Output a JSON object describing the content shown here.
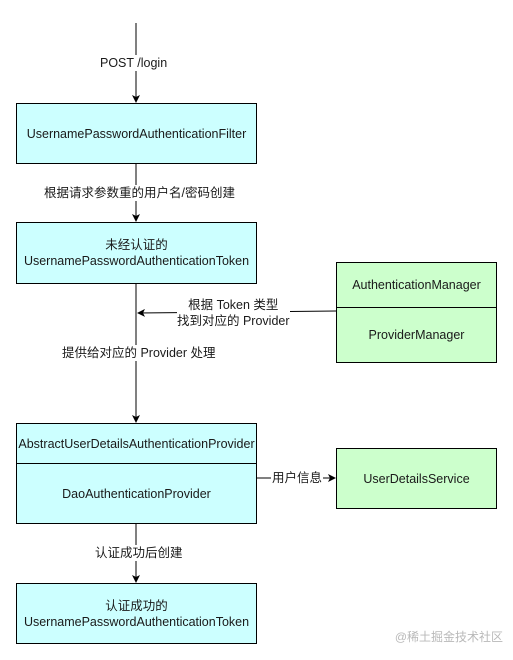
{
  "nodes": {
    "filter": {
      "label": "UsernamePasswordAuthenticationFilter",
      "color": "#ccffff"
    },
    "unauth_token": {
      "line1": "未经认证的",
      "line2": "UsernamePasswordAuthenticationToken",
      "color": "#ccffff"
    },
    "manager": {
      "top": "AuthenticationManager",
      "bottom": "ProviderManager",
      "color": "#ccffcc"
    },
    "provider": {
      "top": "AbstractUserDetailsAuthenticationProvider",
      "bottom": "DaoAuthenticationProvider",
      "color": "#ccffff"
    },
    "user_details_service": {
      "label": "UserDetailsService",
      "color": "#ccffcc"
    },
    "auth_token": {
      "line1": "认证成功的",
      "line2": "UsernamePasswordAuthenticationToken",
      "color": "#ccffff"
    }
  },
  "edges": {
    "post_login": "POST /login",
    "create_from_params": "根据请求参数重的用户名/密码创建",
    "find_provider_line1": "根据 Token 类型",
    "find_provider_line2": "找到对应的 Provider",
    "hand_to_provider": "提供给对应的 Provider 处理",
    "user_info": "用户信息",
    "create_after_success": "认证成功后创建"
  },
  "watermark": "@稀土掘金技术社区"
}
